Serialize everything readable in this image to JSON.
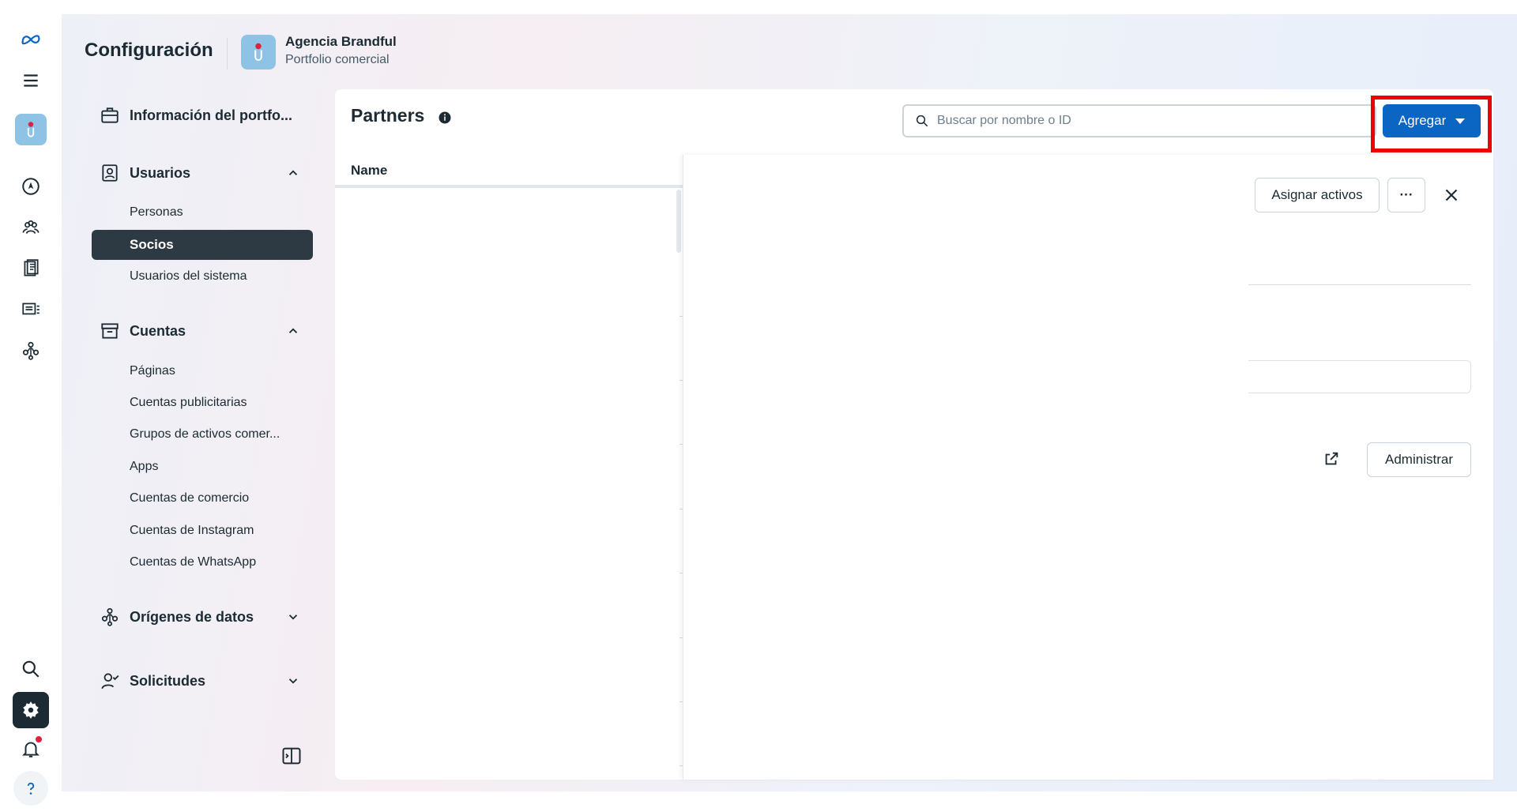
{
  "app": {
    "title": "Configuración"
  },
  "portfolio": {
    "name": "Agencia Brandful",
    "type": "Portfolio comercial"
  },
  "nav": {
    "info": "Información del portfo...",
    "usuarios": {
      "label": "Usuarios",
      "items": [
        "Personas",
        "Socios",
        "Usuarios del sistema"
      ],
      "active": "Socios"
    },
    "cuentas": {
      "label": "Cuentas",
      "items": [
        "Páginas",
        "Cuentas publicitarias",
        "Grupos de activos comer...",
        "Apps",
        "Cuentas de comercio",
        "Cuentas de Instagram",
        "Cuentas de WhatsApp"
      ]
    },
    "origenes": {
      "label": "Orígenes de datos"
    },
    "solicitudes": {
      "label": "Solicitudes"
    }
  },
  "content": {
    "title": "Partners",
    "search_placeholder": "Buscar por nombre o ID",
    "add_button": "Agregar",
    "column_name": "Name"
  },
  "panel": {
    "assign_button": "Asignar activos",
    "more_button": "···",
    "manage_button": "Administrar"
  },
  "colors": {
    "accent": "#0a66c2",
    "active_nav": "#2d3a44",
    "highlight": "#ee0000",
    "notification": "#e41e3f"
  },
  "icons": {
    "rail": [
      "meta-logo-icon",
      "menu-icon",
      "portfolio-avatar",
      "compass-icon",
      "people-icon",
      "pages-icon",
      "ads-icon",
      "data-sources-icon",
      "search-icon",
      "settings-icon",
      "bell-icon",
      "help-icon"
    ]
  }
}
